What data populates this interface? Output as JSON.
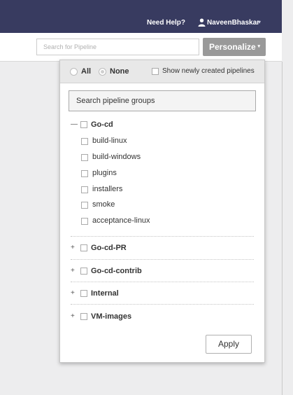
{
  "header": {
    "help_label": "Need Help?",
    "user_icon": "user-icon",
    "user_name": "NaveenBhaskar",
    "user_caret": "▾"
  },
  "toolbar": {
    "search_placeholder": "Search for Pipeline",
    "search_value": "",
    "personalize_label": "Personalize",
    "personalize_caret": "▾"
  },
  "panel": {
    "filter_all_label": "All",
    "filter_all_selected": false,
    "filter_none_label": "None",
    "filter_none_selected": true,
    "show_new_label": "Show newly created pipelines",
    "show_new_checked": false,
    "search_groups_placeholder": "Search pipeline groups",
    "apply_label": "Apply"
  },
  "groups": [
    {
      "toggle": "—",
      "name": "Go-cd",
      "expanded": true,
      "pipelines": [
        {
          "name": "build-linux"
        },
        {
          "name": "build-windows"
        },
        {
          "name": "plugins"
        },
        {
          "name": "installers"
        },
        {
          "name": "smoke"
        },
        {
          "name": "acceptance-linux"
        }
      ]
    },
    {
      "toggle": "+",
      "name": "Go-cd-PR",
      "expanded": false
    },
    {
      "toggle": "+",
      "name": "Go-cd-contrib",
      "expanded": false
    },
    {
      "toggle": "+",
      "name": "Internal",
      "expanded": false
    },
    {
      "toggle": "+",
      "name": "VM-images",
      "expanded": false
    }
  ],
  "colors": {
    "header_bg": "#383b60",
    "personalize_bg": "#999999",
    "page_bg": "#ededee"
  }
}
